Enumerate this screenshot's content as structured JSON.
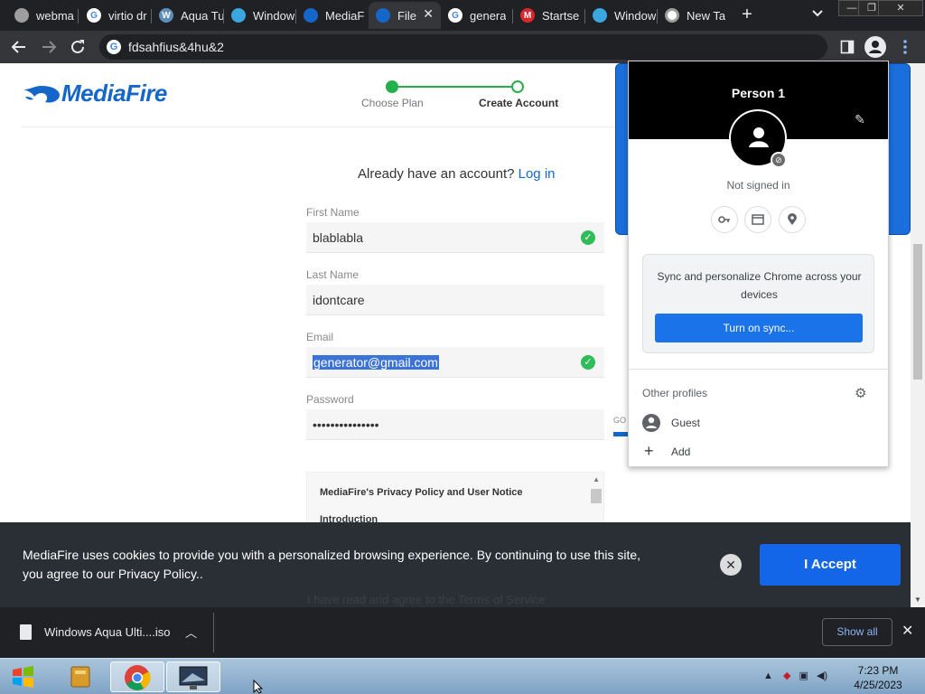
{
  "tabs": [
    {
      "label": "webma",
      "icon": "webmail-icon",
      "color": "#9e9e9e"
    },
    {
      "label": "virtio dr",
      "icon": "google-icon",
      "color": "#ffffff"
    },
    {
      "label": "Aqua Tu",
      "icon": "wordpress-icon",
      "color": "#5b8fb9"
    },
    {
      "label": "Window",
      "icon": "edge-icon",
      "color": "#3ba7e0"
    },
    {
      "label": "MediaF",
      "icon": "mediafire-icon",
      "color": "#1466c8"
    },
    {
      "label": "File",
      "icon": "mediafire-icon",
      "color": "#1466c8",
      "active": true
    },
    {
      "label": "genera",
      "icon": "google-icon",
      "color": "#ffffff"
    },
    {
      "label": "Startse",
      "icon": "mega-icon",
      "color": "#d9272e"
    },
    {
      "label": "Window",
      "icon": "edge-icon",
      "color": "#3ba7e0"
    },
    {
      "label": "New Ta",
      "icon": "chrome-icon",
      "color": "#ffffff"
    }
  ],
  "address": {
    "url": "fdsahfius&4hu&2"
  },
  "site": {
    "logo": "MediaFire",
    "steps": [
      "Choose Plan",
      "Create Account"
    ],
    "already_text": "Already have an account?",
    "login_link": "Log in",
    "fields": {
      "first_name_label": "First Name",
      "first_name_value": "blablabla",
      "last_name_label": "Last Name",
      "last_name_value": "idontcare",
      "email_label": "Email",
      "email_value": "generator@gmail.com",
      "password_label": "Password",
      "password_value": "•••••••••••••••"
    },
    "strength_text": "GO",
    "privacy_title": "MediaFire's Privacy Policy and User Notice",
    "privacy_section": "Introduction",
    "agree_ghost": "I have read and agree to the Terms of Service"
  },
  "cookie": {
    "text": "MediaFire uses cookies to provide you with a personalized browsing experience. By continuing to use this site, you agree to our Privacy Policy..",
    "accept": "I Accept"
  },
  "profile_menu": {
    "name": "Person 1",
    "status": "Not signed in",
    "sync_text": "Sync and personalize Chrome across your devices",
    "sync_button": "Turn on sync...",
    "other_profiles": "Other profiles",
    "guest": "Guest",
    "add": "Add"
  },
  "download": {
    "filename": "Windows Aqua Ulti....iso",
    "show_all": "Show all"
  },
  "taskbar": {
    "time": "7:23 PM",
    "date": "4/25/2023"
  }
}
